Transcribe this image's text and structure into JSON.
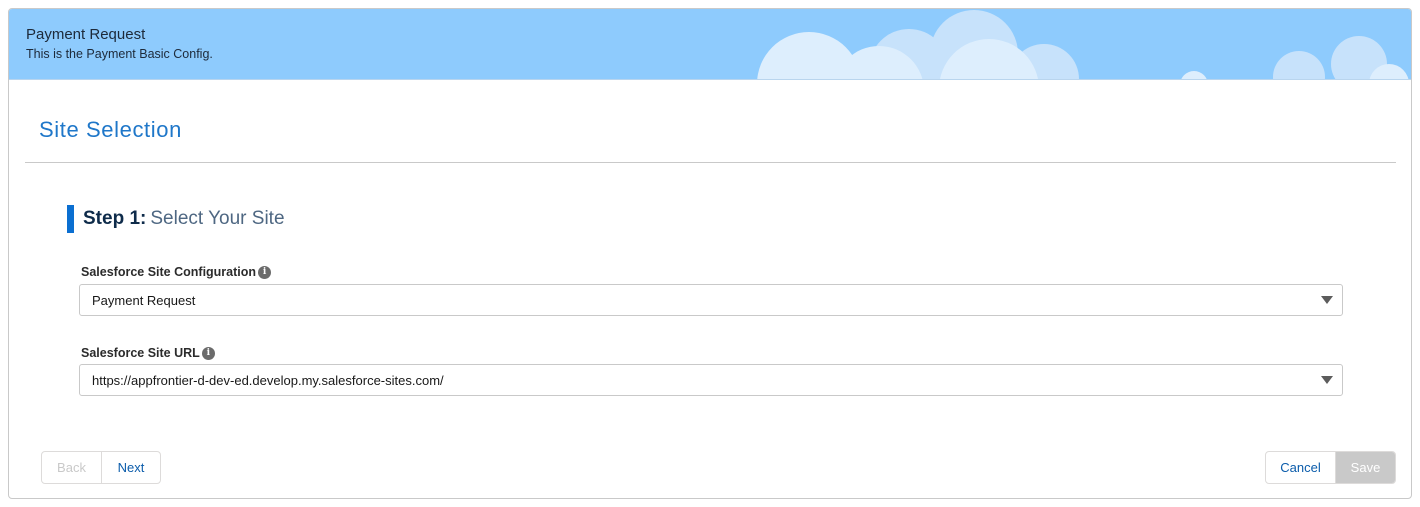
{
  "banner": {
    "title": "Payment Request",
    "subtitle": "This is the Payment Basic Config."
  },
  "section": {
    "title": "Site Selection"
  },
  "step": {
    "prefix": "Step 1:",
    "text": "Select Your Site"
  },
  "fields": {
    "site_config": {
      "label": "Salesforce Site Configuration",
      "value": "Payment Request"
    },
    "site_url": {
      "label": "Salesforce Site URL",
      "value": "https://appfrontier-d-dev-ed.develop.my.salesforce-sites.com/"
    }
  },
  "buttons": {
    "back": "Back",
    "next": "Next",
    "cancel": "Cancel",
    "save": "Save"
  },
  "icons": {
    "info": "i"
  },
  "colors": {
    "banner_bg": "#8ecbfd",
    "accent": "#1f77c9",
    "step_bar": "#0b6fd1",
    "link": "#0b5cab",
    "disabled": "#c9c9c9"
  }
}
